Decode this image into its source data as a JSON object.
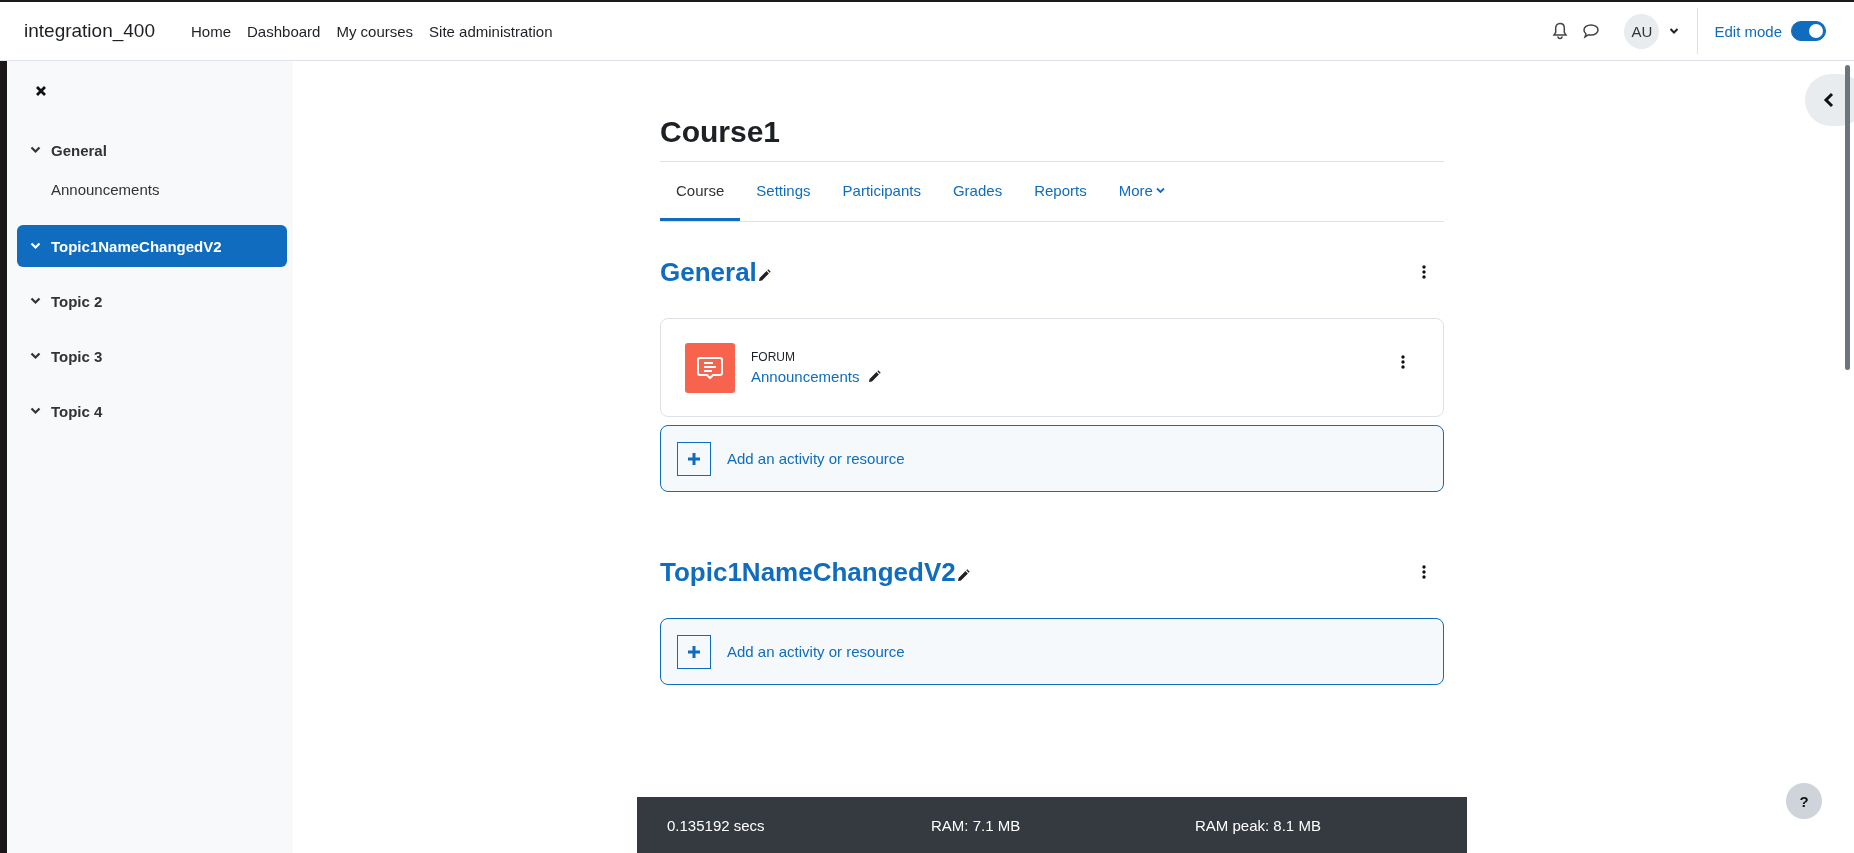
{
  "navbar": {
    "site_name": "integration_400",
    "links": [
      {
        "label": "Home"
      },
      {
        "label": "Dashboard"
      },
      {
        "label": "My courses"
      },
      {
        "label": "Site administration"
      }
    ],
    "avatar": "AU",
    "edit_mode": {
      "label": "Edit mode",
      "on": true
    }
  },
  "sidebar": {
    "items": [
      {
        "label": "General",
        "selected": false,
        "expanded": true,
        "children": [
          {
            "label": "Announcements",
            "selected": false
          }
        ]
      },
      {
        "label": "Topic1NameChangedV2",
        "selected": true,
        "expanded": true
      },
      {
        "label": "Topic 2",
        "selected": false,
        "expanded": true
      },
      {
        "label": "Topic 3",
        "selected": false,
        "expanded": true
      },
      {
        "label": "Topic 4",
        "selected": false,
        "expanded": true
      }
    ]
  },
  "course": {
    "title": "Course1",
    "tabs": [
      {
        "label": "Course",
        "selected": true
      },
      {
        "label": "Settings",
        "selected": false
      },
      {
        "label": "Participants",
        "selected": false
      },
      {
        "label": "Grades",
        "selected": false
      },
      {
        "label": "Reports",
        "selected": false
      },
      {
        "label": "More",
        "selected": false,
        "kind": "dropdown"
      }
    ],
    "sections": [
      {
        "title": "General",
        "activities": [
          {
            "type": "FORUM",
            "name": "Announcements"
          }
        ],
        "add_label": "Add an activity or resource"
      },
      {
        "title": "Topic1NameChangedV2",
        "add_label": "Add an activity or resource"
      }
    ]
  },
  "footer": {
    "items": [
      "0.135192 secs",
      "RAM: 7.1 MB",
      "RAM peak: 8.1 MB"
    ]
  },
  "help_button": "?"
}
